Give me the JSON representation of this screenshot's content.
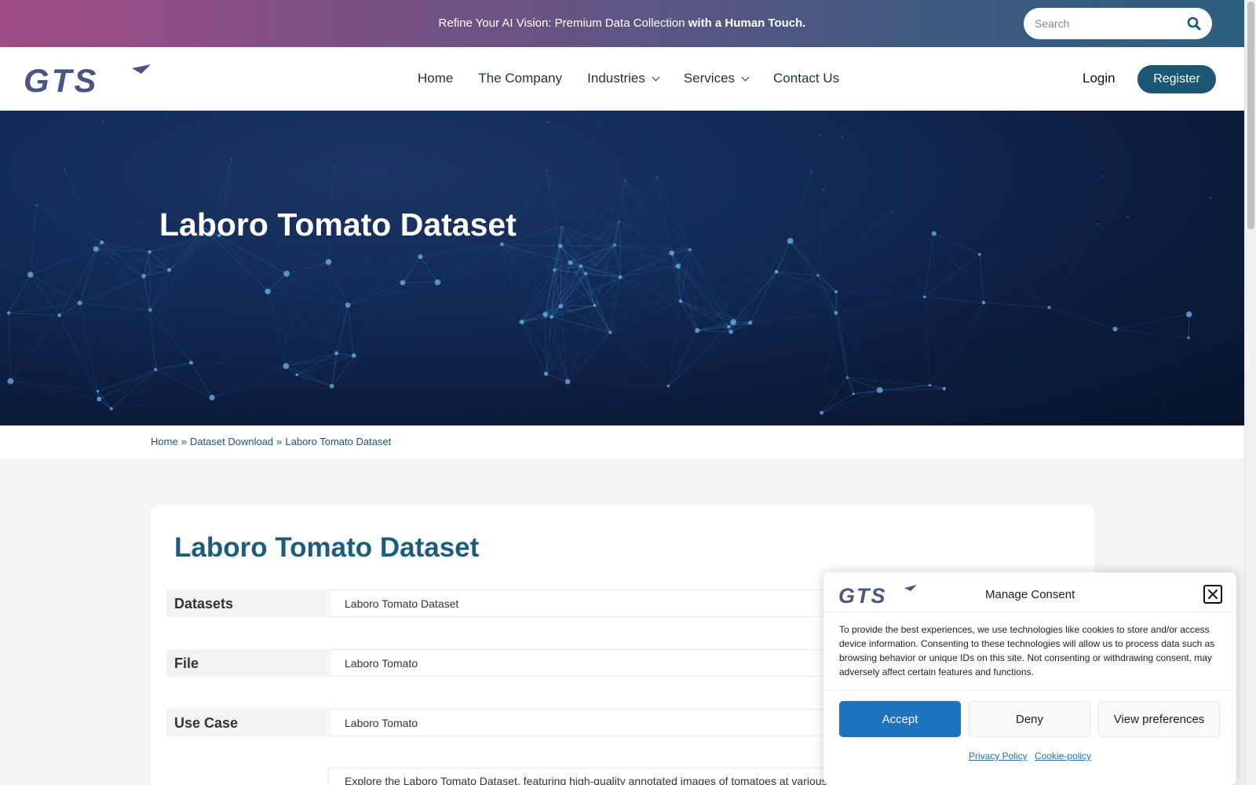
{
  "banner": {
    "text_plain": "Refine Your AI Vision: Premium Data Collection ",
    "text_bold": "with a Human Touch.",
    "search_placeholder": "Search"
  },
  "logo_text": "GTS",
  "nav": {
    "items": [
      {
        "label": "Home",
        "dropdown": false
      },
      {
        "label": "The Company",
        "dropdown": false
      },
      {
        "label": "Industries",
        "dropdown": true
      },
      {
        "label": "Services",
        "dropdown": true
      },
      {
        "label": "Contact Us",
        "dropdown": false
      }
    ],
    "login": "Login",
    "register": "Register"
  },
  "hero": {
    "title": "Laboro Tomato Dataset"
  },
  "breadcrumb": {
    "items": [
      "Home",
      "Dataset Download",
      "Laboro Tomato Dataset"
    ],
    "separator": "»"
  },
  "content": {
    "title": "Laboro Tomato Dataset",
    "rows": [
      {
        "label": "Datasets",
        "value": "Laboro Tomato Dataset"
      },
      {
        "label": "File",
        "value": "Laboro Tomato"
      },
      {
        "label": "Use Case",
        "value": "Laboro Tomato"
      }
    ],
    "description": "Explore the Laboro Tomato Dataset, featuring high-quality annotated images of tomatoes at various ripening stages. Perfect for"
  },
  "consent": {
    "title": "Manage Consent",
    "body": "To provide the best experiences, we use technologies like cookies to store and/or access device information. Consenting to these technologies will allow us to process data such as browsing behavior or unique IDs on this site. Not consenting or withdrawing consent, may adversely affect certain features and functions.",
    "accept": "Accept",
    "deny": "Deny",
    "preferences": "View preferences",
    "privacy_link": "Privacy Policy",
    "cookie_link": "Cookie-policy"
  },
  "colors": {
    "brand": "#1b5672",
    "title_blue": "#1c5d7b",
    "accept_blue": "#1e73be",
    "logo_grey": "#4a5580"
  },
  "icons": [
    "search-icon",
    "chevron-down-icon",
    "close-icon",
    "gts-logo"
  ]
}
